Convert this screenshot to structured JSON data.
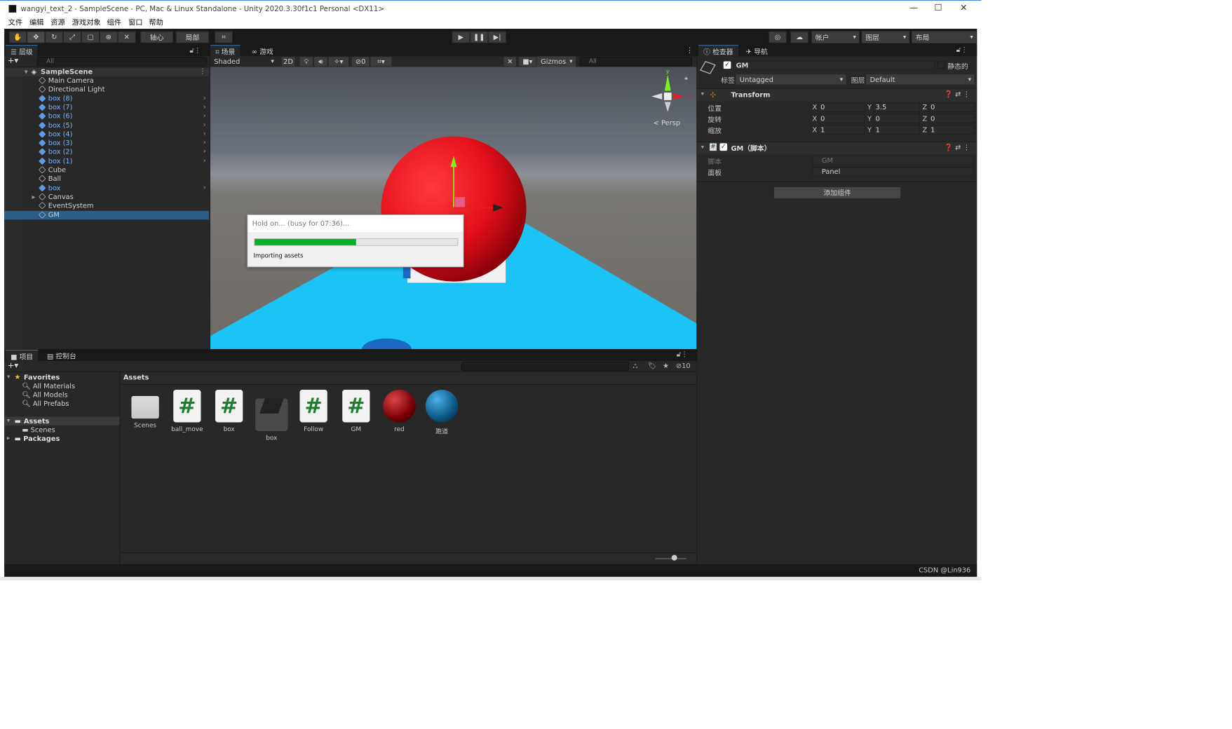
{
  "window": {
    "title": "wangyi_text_2 - SampleScene - PC, Mac & Linux Standalone - Unity 2020.3.30f1c1 Personal <DX11>",
    "min": "—",
    "max": "☐",
    "close": "✕"
  },
  "menu": [
    "文件",
    "编辑",
    "资源",
    "游戏对象",
    "组件",
    "窗口",
    "帮助"
  ],
  "toolbar": {
    "pivot": "轴心",
    "local": "局部",
    "account": "帐户",
    "layers": "图层",
    "layout": "布局"
  },
  "hierarchy": {
    "tab": "层级",
    "search_placeholder": "All",
    "scene": "SampleScene",
    "items": [
      {
        "label": "Main Camera",
        "prefab": false
      },
      {
        "label": "Directional Light",
        "prefab": false
      },
      {
        "label": "box (8)",
        "prefab": true
      },
      {
        "label": "box (7)",
        "prefab": true
      },
      {
        "label": "box (6)",
        "prefab": true
      },
      {
        "label": "box (5)",
        "prefab": true
      },
      {
        "label": "box (4)",
        "prefab": true
      },
      {
        "label": "box (3)",
        "prefab": true
      },
      {
        "label": "box (2)",
        "prefab": true
      },
      {
        "label": "box (1)",
        "prefab": true
      },
      {
        "label": "Cube",
        "prefab": false
      },
      {
        "label": "Ball",
        "prefab": false
      },
      {
        "label": "box",
        "prefab": true
      },
      {
        "label": "Canvas",
        "prefab": false
      },
      {
        "label": "EventSystem",
        "prefab": false
      },
      {
        "label": "GM",
        "prefab": false,
        "selected": true
      }
    ]
  },
  "scene_view": {
    "tab_scene": "场景",
    "tab_game": "游戏",
    "shading": "Shaded",
    "mode2d": "2D",
    "hidden_count": "0",
    "gizmos": "Gizmos",
    "search_placeholder": "All",
    "persp": "< Persp"
  },
  "dialog": {
    "title": "Hold on... (busy for 07:36)...",
    "progress": 0.5,
    "message": "Importing assets"
  },
  "inspector": {
    "tab": "检查器",
    "tab_nav": "导航",
    "object_name": "GM",
    "static_label": "静态的",
    "tag_label": "标签",
    "tag_value": "Untagged",
    "layer_label": "图层",
    "layer_value": "Default",
    "transform": {
      "title": "Transform",
      "rows": [
        {
          "label": "位置",
          "x": "0",
          "y": "3.5",
          "z": "0"
        },
        {
          "label": "旋转",
          "x": "0",
          "y": "0",
          "z": "0"
        },
        {
          "label": "缩放",
          "x": "1",
          "y": "1",
          "z": "1"
        }
      ]
    },
    "script": {
      "title": "GM（脚本）",
      "script_label": "脚本",
      "script_value": "GM",
      "panel_label": "面板",
      "panel_value": "Panel"
    },
    "add_component": "添加组件"
  },
  "project": {
    "tab": "项目",
    "tab_console": "控制台",
    "hidden_count": "10",
    "favorites": "Favorites",
    "fav_items": [
      "All Materials",
      "All Models",
      "All Prefabs"
    ],
    "assets": "Assets",
    "scenes": "Scenes",
    "packages": "Packages",
    "breadcrumb": "Assets",
    "items": [
      {
        "name": "Scenes",
        "kind": "folder"
      },
      {
        "name": "ball_move",
        "kind": "script"
      },
      {
        "name": "box",
        "kind": "script"
      },
      {
        "name": "box",
        "kind": "prefab"
      },
      {
        "name": "Follow",
        "kind": "script"
      },
      {
        "name": "GM",
        "kind": "script"
      },
      {
        "name": "red",
        "kind": "material-red"
      },
      {
        "name": "跑道",
        "kind": "material-blue"
      }
    ]
  },
  "statusbar": {
    "watermark": "CSDN @Lin936"
  },
  "colors": {
    "accent": "#2c5d87",
    "ball": "#e3101a",
    "floor": "#1bc4f5",
    "progress": "#06b025"
  }
}
